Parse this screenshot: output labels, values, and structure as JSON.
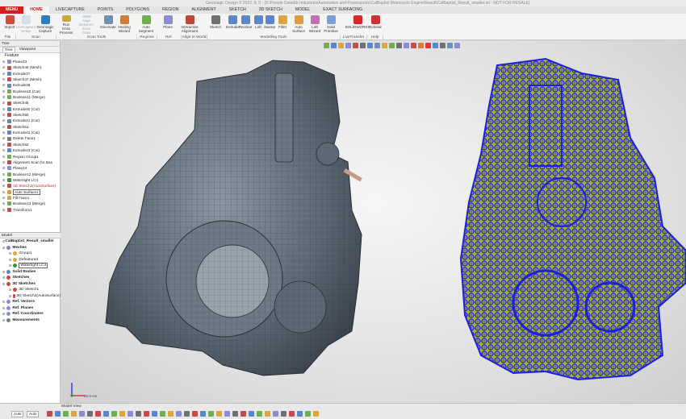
{
  "window": {
    "title": "Geomagic Design X 2022. 0. 0 - [X:\\People Data\\Ek Industries\\Automotive and Powersports\\CalBaptist Motorcycle Engine\\Result\\CalBaptist_Result_smaller.xrl - NOT FOR RESALE]"
  },
  "menubar": {
    "items": [
      "MENU",
      "HOME",
      "LIVECAPTURE",
      "POINTS",
      "POLYGONS",
      "REGION",
      "ALIGNMENT",
      "SKETCH",
      "3D SKETCH",
      "MODEL",
      "EXACT SURFACING"
    ],
    "active": "HOME"
  },
  "ribbon": {
    "buttons": [
      {
        "id": "import",
        "label": "Import",
        "color": "#d44a3a"
      },
      {
        "id": "livecapture",
        "label": "LiveCapture Setup",
        "color": "#9ab7d6",
        "disabled": true
      },
      {
        "id": "geomagic-capture",
        "label": "Geomagic Capture",
        "color": "#2b7fc9"
      },
      {
        "id": "run-scan",
        "label": "Run Scan Process",
        "color": "#c9a93a"
      },
      {
        "id": "align-between",
        "label": "Align Between Scan Data",
        "color": "#8aa0b7",
        "disabled": true
      },
      {
        "id": "decimate",
        "label": "Decimate",
        "color": "#6f8fb3"
      },
      {
        "id": "healing",
        "label": "Healing Wizard",
        "color": "#d77b38"
      },
      {
        "id": "auto-segment",
        "label": "Auto Segment",
        "color": "#6fae52"
      },
      {
        "id": "plane",
        "label": "Plane",
        "color": "#8b8bd6"
      },
      {
        "id": "interactive-alignment",
        "label": "Interactive Alignment",
        "color": "#c0473b"
      },
      {
        "id": "sketch",
        "label": "Sketch",
        "color": "#707070"
      },
      {
        "id": "extrude",
        "label": "Extrude",
        "color": "#5b86c7"
      },
      {
        "id": "revolve",
        "label": "Revolve",
        "color": "#5b86c7"
      },
      {
        "id": "loft",
        "label": "Loft",
        "color": "#5b86c7"
      },
      {
        "id": "sweep",
        "label": "Sweep",
        "color": "#5b86c7"
      },
      {
        "id": "fillet",
        "label": "Fillet",
        "color": "#d9a640"
      },
      {
        "id": "auto-surface",
        "label": "Auto Surface",
        "color": "#e39a3c"
      },
      {
        "id": "loft-wizard",
        "label": "Loft Wizard",
        "color": "#c76fb5"
      },
      {
        "id": "solid-primitive",
        "label": "Solid Primitive",
        "color": "#7a9fd6"
      },
      {
        "id": "solidworks",
        "label": "SOLIDWORKS",
        "color": "#d42a2a"
      },
      {
        "id": "tutorial",
        "label": "Tutorial",
        "color": "#cc3333"
      }
    ],
    "groups": [
      "File",
      "Scan",
      "Scan Tools",
      "Regions",
      "Ref. Geometry",
      "Align to World",
      "Modelling Tools",
      "LiveTransfer",
      "Help"
    ]
  },
  "tree_panel": {
    "title": "Tree",
    "tabs": [
      "Tree",
      "Viewpoint"
    ],
    "feature_label": "Feature",
    "features": [
      {
        "label": "Plane23",
        "icon": "#8b8bd6"
      },
      {
        "label": "Sketch46 (Mesh)",
        "icon": "#c94a4a"
      },
      {
        "label": "Extrude37",
        "icon": "#5b86c7"
      },
      {
        "label": "Sketch47 (Mesh)",
        "icon": "#c94a4a"
      },
      {
        "label": "Extrude38",
        "icon": "#5b86c7"
      },
      {
        "label": "Boolean10 (Cut)",
        "icon": "#6fae52"
      },
      {
        "label": "Boolean11 (Merge)",
        "icon": "#6fae52"
      },
      {
        "label": "Sketch48",
        "icon": "#c94a4a"
      },
      {
        "label": "Extrude40 (Cut)",
        "icon": "#5b86c7"
      },
      {
        "label": "Sketch50",
        "icon": "#c94a4a"
      },
      {
        "label": "Extrude41 (Cut)",
        "icon": "#5b86c7"
      },
      {
        "label": "Sketch51",
        "icon": "#c94a4a"
      },
      {
        "label": "Extrude42 (Cut)",
        "icon": "#5b86c7"
      },
      {
        "label": "Delete Face1",
        "icon": "#7a7a7a"
      },
      {
        "label": "Sketch52",
        "icon": "#c94a4a"
      },
      {
        "label": "Extrude43 (Cut)",
        "icon": "#5b86c7"
      },
      {
        "label": "Region Group1",
        "icon": "#6fae52"
      },
      {
        "label": "Alignment Scan for Bas",
        "icon": "#c0473b"
      },
      {
        "label": "Plane24",
        "icon": "#8b8bd6"
      },
      {
        "label": "Boolean12 (Merge)",
        "icon": "#6fae52"
      },
      {
        "label": "Watertight LC4",
        "icon": "#3a8f3a"
      },
      {
        "label": "3D Sketch2(AutoSurface)",
        "icon": "#c94a4a",
        "style": "red"
      },
      {
        "label": "Auto Surface1",
        "icon": "#e39a3c",
        "style": "boxed"
      },
      {
        "label": "Fill Face1",
        "icon": "#d9a640"
      },
      {
        "label": "Boolean13 (Merge)",
        "icon": "#6fae52"
      },
      {
        "label": "Transform1",
        "icon": "#c94a4a"
      }
    ]
  },
  "model_panel": {
    "title": "Model",
    "rows": [
      {
        "label": "CalBaptist_Result_smaller",
        "bold": true,
        "indent": 0,
        "icon": ""
      },
      {
        "label": "Meshes",
        "bold": true,
        "indent": 0,
        "icon": "#6f8fb3"
      },
      {
        "label": "Group1",
        "bold": false,
        "indent": 2,
        "icon": "#d9a640"
      },
      {
        "label": "Defeatured",
        "bold": false,
        "indent": 2,
        "icon": "#d9a640"
      },
      {
        "label": "Watertight LC4",
        "bold": false,
        "indent": 2,
        "icon": "#3a8f3a",
        "boxed": true
      },
      {
        "label": "Solid Bodies",
        "bold": true,
        "indent": 0,
        "icon": "#5b86c7"
      },
      {
        "label": "Sketches",
        "bold": true,
        "indent": 0,
        "icon": "#c94a4a"
      },
      {
        "label": "3D Sketches",
        "bold": true,
        "indent": 0,
        "icon": "#c94a4a"
      },
      {
        "label": "3D Sketch1",
        "bold": false,
        "indent": 2,
        "icon": "#c94a4a"
      },
      {
        "label": "3D Sketch2(AutoSurface)",
        "bold": false,
        "indent": 2,
        "icon": "#c94a4a"
      },
      {
        "label": "Ref. Vectors",
        "bold": true,
        "indent": 0,
        "icon": "#8b8bd6"
      },
      {
        "label": "Ref. Planes",
        "bold": true,
        "indent": 0,
        "icon": "#8b8bd6"
      },
      {
        "label": "Ref. Coordinates",
        "bold": true,
        "indent": 0,
        "icon": "#8b8bd6"
      },
      {
        "label": "Measurements",
        "bold": true,
        "indent": 0,
        "icon": "#7a7a7a"
      }
    ]
  },
  "viewport": {
    "scale_label": "20.0 cm",
    "colors": {
      "mesh": "#5b6672",
      "wire": "#1c20e0",
      "surface": "#a8b030"
    }
  },
  "statusbar": {
    "title": "Model View",
    "select_1": "Auto",
    "select_2": "Auto"
  }
}
